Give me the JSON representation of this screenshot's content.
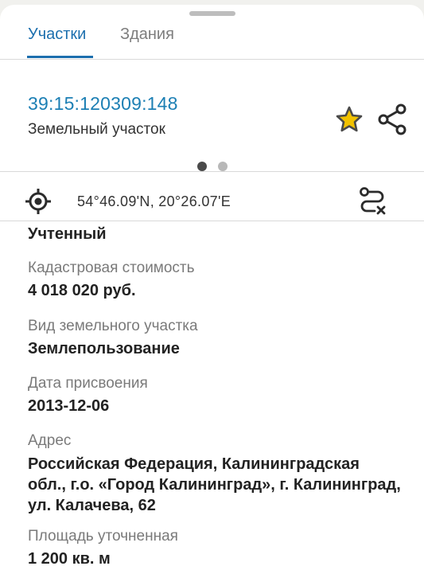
{
  "tabs": {
    "land": "Участки",
    "buildings": "Здания"
  },
  "object": {
    "cadastral_number": "39:15:120309:148",
    "type": "Земельный участок"
  },
  "location": {
    "coordinates": "54°46.09'N, 20°26.07'E"
  },
  "details": {
    "status": "Учтенный",
    "cadastral_value_label": "Кадастровая стоимость",
    "cadastral_value": "4 018 020 руб.",
    "land_type_label": "Вид земельного участка",
    "land_type": "Землепользование",
    "assign_date_label": "Дата присвоения",
    "assign_date": "2013-12-06",
    "address_label": "Адрес",
    "address": "Российская Федерация, Калининградская обл., г.о. «Город Калининград», г. Калининград, ул. Калачева, 62",
    "area_label": "Площадь уточненная",
    "area": "1 200 кв. м"
  },
  "colors": {
    "accent": "#1c6fae",
    "link": "#1c7fb4",
    "star": "#f2c200"
  },
  "icons": [
    "star-icon",
    "share-icon",
    "locate-icon",
    "route-icon"
  ]
}
